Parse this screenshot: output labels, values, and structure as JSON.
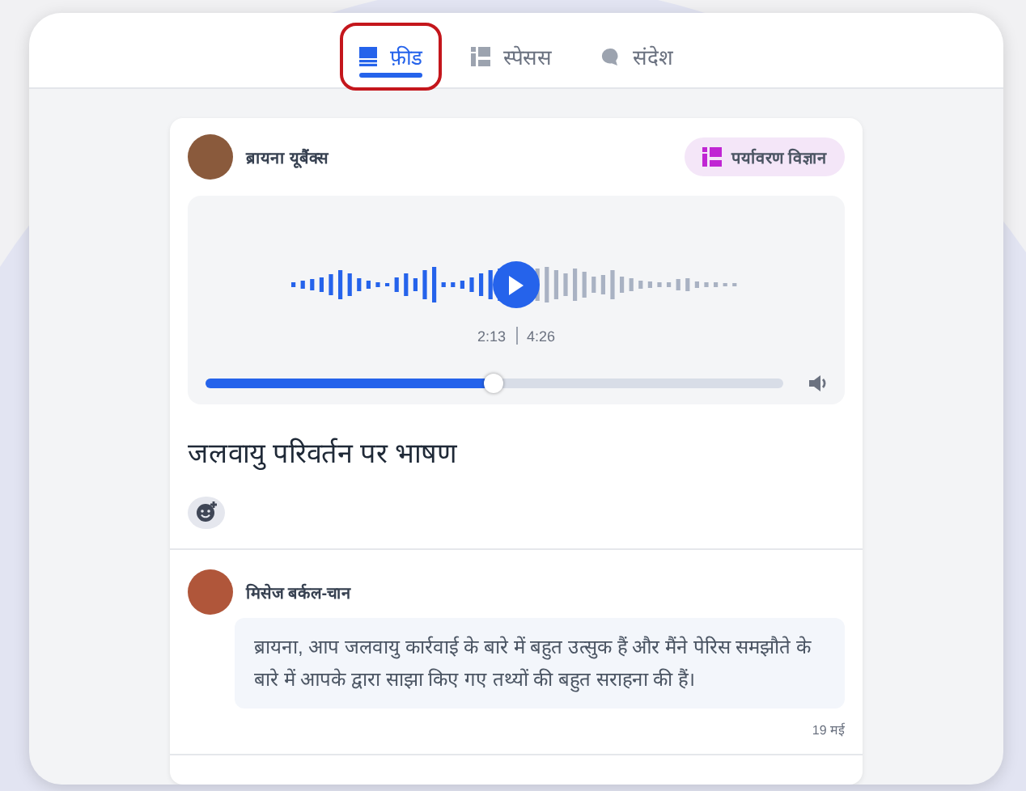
{
  "tabs": [
    {
      "label": "फ़ीड",
      "kind": "feed",
      "selected": true,
      "highlighted": true
    },
    {
      "label": "स्पेसस",
      "kind": "spaces",
      "selected": false,
      "highlighted": false
    },
    {
      "label": "संदेश",
      "kind": "messages",
      "selected": false,
      "highlighted": false
    }
  ],
  "post": {
    "author": "ब्रायना यूबैंक्स",
    "space_tag": "पर्यावरण विज्ञान",
    "audio": {
      "elapsed": "2:13",
      "duration": "4:26",
      "level": 0.5
    },
    "title": "जलवायु परिवर्तन पर भाषण"
  },
  "comments": [
    {
      "author": "मिसेज बर्कल-चान",
      "text": "ब्रायना, आप जलवायु कार्रवाई के बारे में बहुत उत्सुक हैं और मैंने पेरिस समझौते के बारे में आपके द्वारा साझा किए गए तथ्यों की बहुत सराहना की हैं।",
      "date": "19 मई"
    }
  ]
}
